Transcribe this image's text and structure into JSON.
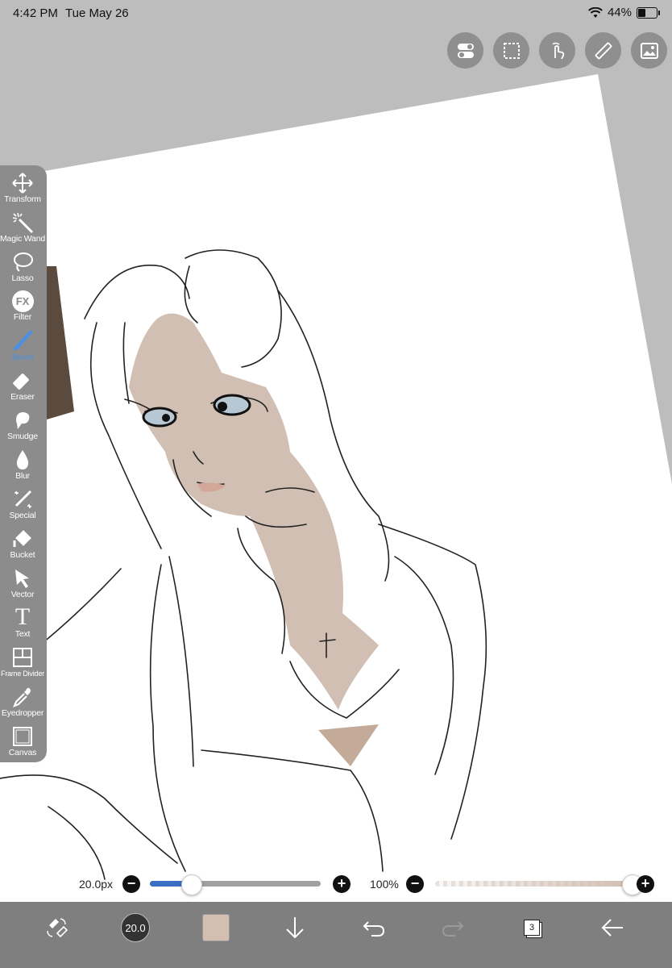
{
  "status_bar": {
    "time": "4:42 PM",
    "date": "Tue May 26",
    "battery_pct": "44%",
    "battery_level": 0.44
  },
  "top_tools": [
    {
      "name": "toggle-icon"
    },
    {
      "name": "selection-icon"
    },
    {
      "name": "gesture-icon"
    },
    {
      "name": "ruler-icon"
    },
    {
      "name": "material-icon"
    }
  ],
  "toolbar": {
    "active_tool": "Brush",
    "tools": [
      {
        "label": "Transform",
        "icon": "move-arrows-icon"
      },
      {
        "label": "Magic Wand",
        "icon": "magic-wand-icon"
      },
      {
        "label": "Lasso",
        "icon": "lasso-icon"
      },
      {
        "label": "Filter",
        "icon": "fx-icon",
        "glyph": "FX"
      },
      {
        "label": "Brush",
        "icon": "brush-icon"
      },
      {
        "label": "Eraser",
        "icon": "eraser-icon"
      },
      {
        "label": "Smudge",
        "icon": "smudge-icon"
      },
      {
        "label": "Blur",
        "icon": "blur-drop-icon"
      },
      {
        "label": "Special",
        "icon": "special-icon"
      },
      {
        "label": "Bucket",
        "icon": "bucket-icon"
      },
      {
        "label": "Vector",
        "icon": "vector-arrow-icon"
      },
      {
        "label": "Text",
        "icon": "text-icon",
        "glyph": "T"
      },
      {
        "label": "Frame Divider",
        "icon": "frame-divider-icon"
      },
      {
        "label": "Eyedropper",
        "icon": "eyedropper-icon"
      },
      {
        "label": "Canvas",
        "icon": "canvas-icon"
      }
    ]
  },
  "sliders": {
    "size": {
      "label": "20.0px",
      "minus": "−",
      "plus": "+",
      "fraction": 0.24
    },
    "opacity": {
      "label": "100%",
      "minus": "−",
      "plus": "+",
      "fraction": 1.0
    }
  },
  "bottom_bar": {
    "brush_size": "20.0",
    "color": "#d2bfb2",
    "layers_count": "3"
  },
  "colors": {
    "accent": "#4a8fe7",
    "toolbar_bg": "#8c8c8c",
    "skin": "#c9b4a6"
  }
}
